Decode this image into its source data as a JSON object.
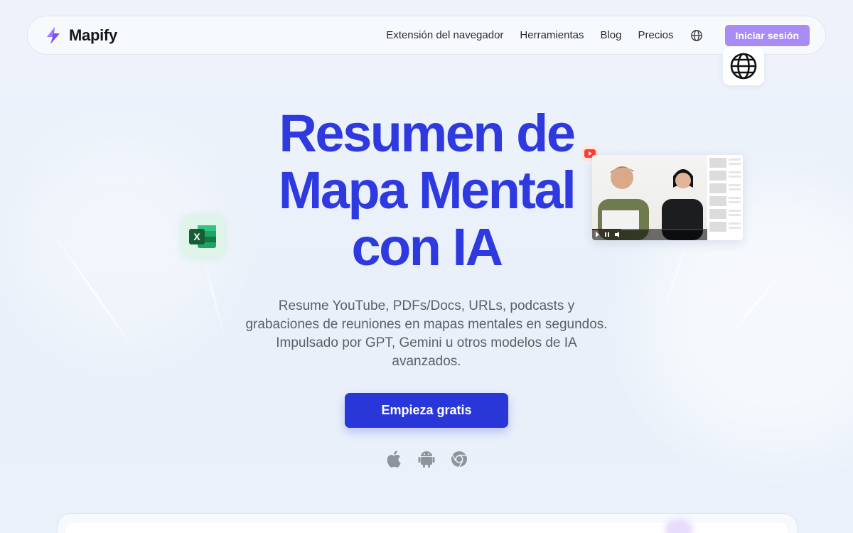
{
  "brand": {
    "name": "Mapify",
    "accent": "#2f39e0",
    "logo_color": "#7c4dff"
  },
  "nav": {
    "links": [
      "Extensión del navegador",
      "Herramientas",
      "Blog",
      "Precios"
    ],
    "language_icon": "globe-icon",
    "signin_label": "Iniciar sesión",
    "signin_color": "#a98bf5"
  },
  "hero": {
    "title_lines": [
      "Resumen de",
      "Mapa Mental",
      "con IA"
    ],
    "subtitle": "Resume YouTube, PDFs/Docs, URLs, podcasts y grabaciones de reuniones en mapas mentales en segundos. Impulsado por GPT, Gemini u otros modelos de IA avanzados.",
    "cta_label": "Empieza gratis",
    "cta_color": "#2a37d8",
    "platforms": [
      "apple-icon",
      "android-icon",
      "chrome-icon"
    ]
  },
  "floating": {
    "globe_card_icon": "globe-icon",
    "excel_card_icon": "excel-icon",
    "youtube_badge_icon": "youtube-icon",
    "video_progress": 0.25
  }
}
